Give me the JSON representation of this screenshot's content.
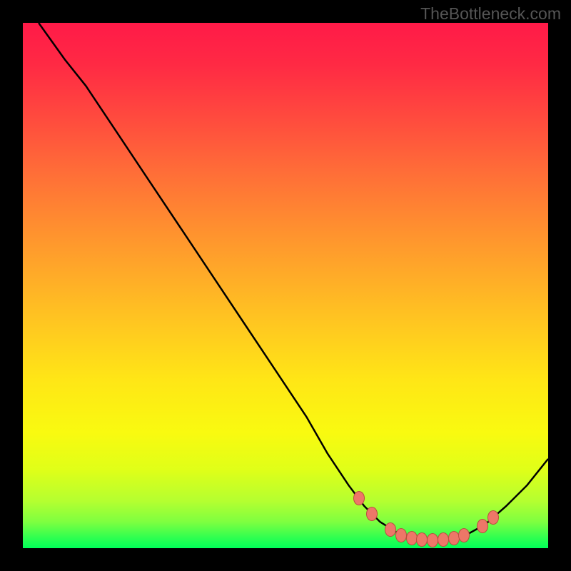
{
  "watermark": "TheBottleneck.com",
  "chart_data": {
    "type": "line",
    "title": "",
    "xlabel": "",
    "ylabel": "",
    "x_range": [
      0,
      100
    ],
    "y_range": [
      0,
      100
    ],
    "curve_points": [
      {
        "x": 3,
        "y": 100
      },
      {
        "x": 8,
        "y": 93
      },
      {
        "x": 12,
        "y": 88
      },
      {
        "x": 18,
        "y": 79
      },
      {
        "x": 24,
        "y": 70
      },
      {
        "x": 30,
        "y": 61
      },
      {
        "x": 36,
        "y": 52
      },
      {
        "x": 42,
        "y": 43
      },
      {
        "x": 48,
        "y": 34
      },
      {
        "x": 54,
        "y": 25
      },
      {
        "x": 58,
        "y": 18
      },
      {
        "x": 62,
        "y": 12
      },
      {
        "x": 65,
        "y": 8
      },
      {
        "x": 68,
        "y": 5
      },
      {
        "x": 72,
        "y": 2.5
      },
      {
        "x": 76,
        "y": 1.5
      },
      {
        "x": 80,
        "y": 1.5
      },
      {
        "x": 84,
        "y": 2.3
      },
      {
        "x": 88,
        "y": 4.5
      },
      {
        "x": 92,
        "y": 8
      },
      {
        "x": 96,
        "y": 12
      },
      {
        "x": 100,
        "y": 17
      }
    ],
    "marker_points": [
      {
        "x": 64,
        "y": 9.5
      },
      {
        "x": 66.5,
        "y": 6.5
      },
      {
        "x": 70,
        "y": 3.5
      },
      {
        "x": 72,
        "y": 2.5
      },
      {
        "x": 74,
        "y": 1.9
      },
      {
        "x": 76,
        "y": 1.6
      },
      {
        "x": 78,
        "y": 1.5
      },
      {
        "x": 80,
        "y": 1.6
      },
      {
        "x": 82,
        "y": 1.9
      },
      {
        "x": 84,
        "y": 2.4
      },
      {
        "x": 87.5,
        "y": 4.2
      },
      {
        "x": 89.5,
        "y": 5.8
      }
    ],
    "colors": {
      "curve": "#000000",
      "marker_fill": "#ed7768",
      "marker_stroke": "#b94e3f"
    }
  }
}
